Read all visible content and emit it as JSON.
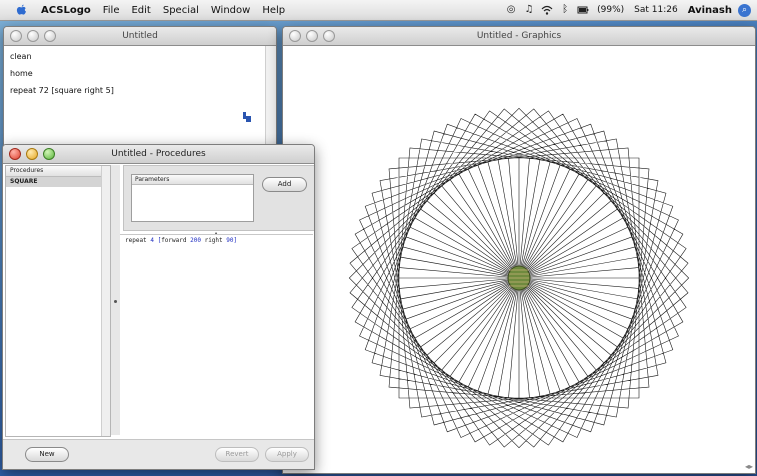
{
  "menubar": {
    "app_name": "ACSLogo",
    "items": [
      "File",
      "Edit",
      "Special",
      "Window",
      "Help"
    ],
    "battery": "(99%)",
    "clock": "Sat 11:26",
    "user": "Avinash"
  },
  "listener_window": {
    "title": "Untitled",
    "lines": [
      "clean",
      "home",
      "repeat 72 [square right 5]"
    ]
  },
  "graphics_window": {
    "title": "Untitled - Graphics"
  },
  "procedures_window": {
    "title": "Untitled - Procedures",
    "list_header": "Procedures",
    "procedures": [
      "SQUARE"
    ],
    "params_header": "Parameters",
    "add_label": "Add",
    "code": {
      "kw_repeat": "repeat",
      "count": "4",
      "bracket_open": "[",
      "kw_forward": "forward",
      "distance": "200",
      "kw_right": "right",
      "angle": "90",
      "bracket_close": "]"
    },
    "new_label": "New",
    "revert_label": "Revert",
    "apply_label": "Apply"
  },
  "colors": {
    "desktop": "#4f86c3",
    "code_value": "#1c2bc0"
  }
}
